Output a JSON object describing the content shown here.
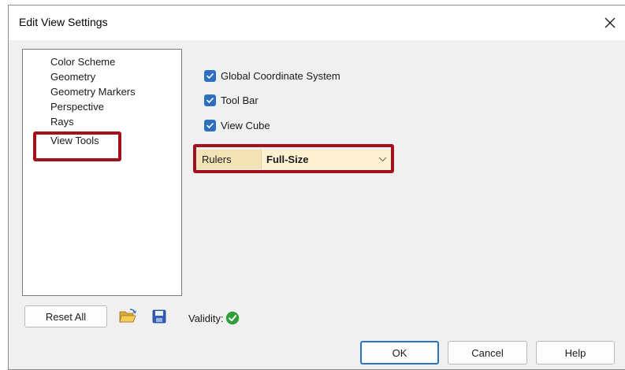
{
  "dialog": {
    "title": "Edit View Settings",
    "close_icon": "close-icon"
  },
  "nav": {
    "items": [
      {
        "label": "Color Scheme"
      },
      {
        "label": "Geometry"
      },
      {
        "label": "Geometry Markers"
      },
      {
        "label": "Perspective"
      },
      {
        "label": "Rays"
      },
      {
        "label": "View Tools"
      }
    ],
    "selected": "View Tools"
  },
  "view_tools": {
    "checkboxes": [
      {
        "label": "Global Coordinate System",
        "checked": true
      },
      {
        "label": "Tool Bar",
        "checked": true
      },
      {
        "label": "View Cube",
        "checked": true
      }
    ],
    "rulers": {
      "label": "Rulers",
      "value": "Full-Size"
    }
  },
  "footer": {
    "reset_all_label": "Reset All",
    "open_icon": "folder-open-icon",
    "save_icon": "save-icon",
    "validity_label": "Validity:",
    "validity_icon": "check-circle-icon",
    "ok_label": "OK",
    "cancel_label": "Cancel",
    "help_label": "Help"
  },
  "colors": {
    "highlight": "#a3111c",
    "checkbox": "#2f6fbf",
    "valid": "#2e9d3a",
    "rulers_background": "#fdf1d2"
  }
}
